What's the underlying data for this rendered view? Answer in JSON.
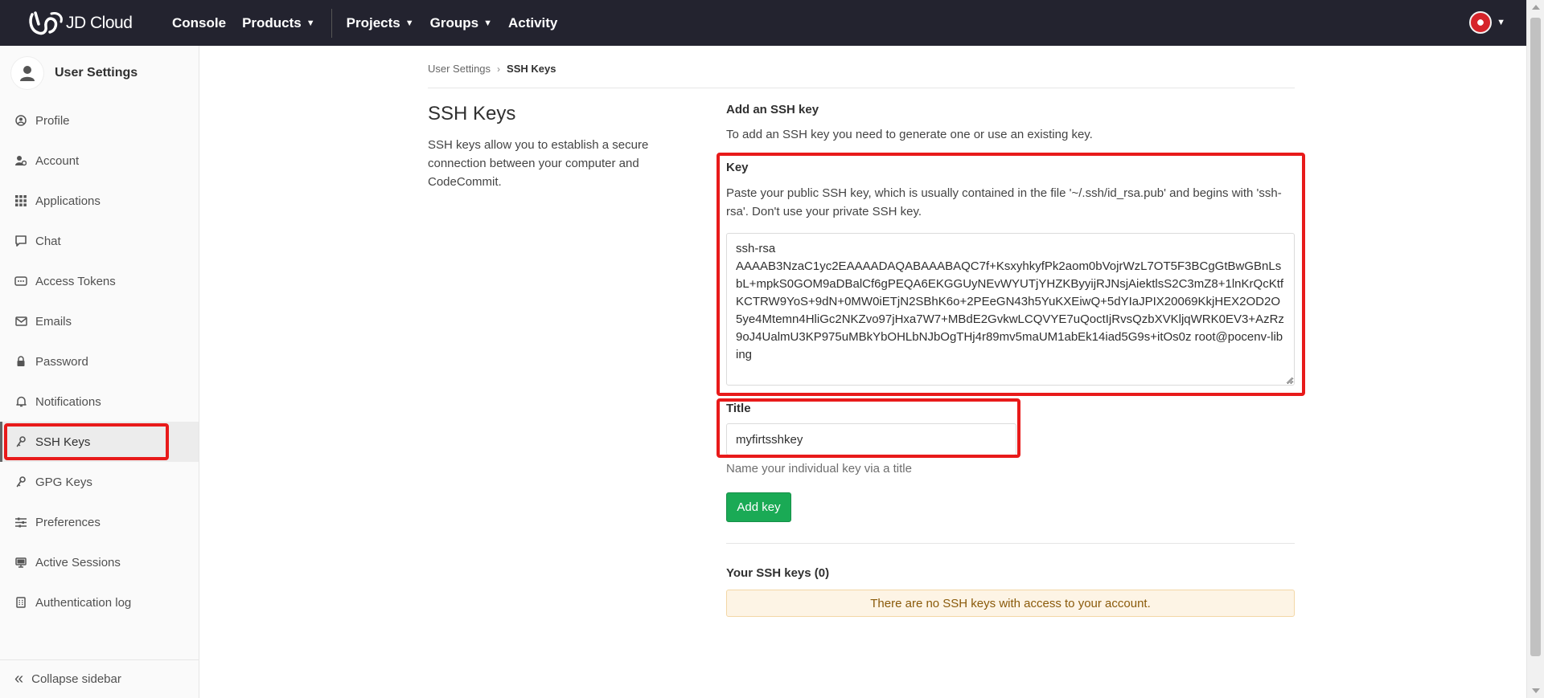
{
  "topnav": {
    "brand": "JD Cloud",
    "items": [
      {
        "label": "Console",
        "caret": false
      },
      {
        "label": "Products",
        "caret": true
      },
      {
        "label": "Projects",
        "caret": true
      },
      {
        "label": "Groups",
        "caret": true
      },
      {
        "label": "Activity",
        "caret": false
      }
    ],
    "icons": [
      "jdcloud-logo-icon",
      "user-avatar-icon",
      "chevron-down-icon"
    ]
  },
  "sidebar": {
    "title": "User Settings",
    "items": [
      {
        "label": "Profile",
        "icon": "profile-icon"
      },
      {
        "label": "Account",
        "icon": "account-icon"
      },
      {
        "label": "Applications",
        "icon": "applications-icon"
      },
      {
        "label": "Chat",
        "icon": "chat-icon"
      },
      {
        "label": "Access Tokens",
        "icon": "token-icon"
      },
      {
        "label": "Emails",
        "icon": "email-icon"
      },
      {
        "label": "Password",
        "icon": "lock-icon"
      },
      {
        "label": "Notifications",
        "icon": "bell-icon"
      },
      {
        "label": "SSH Keys",
        "icon": "key-icon",
        "active": true
      },
      {
        "label": "GPG Keys",
        "icon": "key-icon"
      },
      {
        "label": "Preferences",
        "icon": "preferences-icon"
      },
      {
        "label": "Active Sessions",
        "icon": "monitor-icon"
      },
      {
        "label": "Authentication log",
        "icon": "log-icon"
      }
    ],
    "collapse_label": "Collapse sidebar"
  },
  "breadcrumb": {
    "parent": "User Settings",
    "current": "SSH Keys"
  },
  "page": {
    "title": "SSH Keys",
    "description": "SSH keys allow you to establish a secure connection between your computer and CodeCommit."
  },
  "form": {
    "section_title": "Add an SSH key",
    "section_subtitle": "To add an SSH key you need to generate one or use an existing key.",
    "key_label": "Key",
    "key_help": "Paste your public SSH key, which is usually contained in the file '~/.ssh/id_rsa.pub' and begins with 'ssh-rsa'. Don't use your private SSH key.",
    "key_value": "ssh-rsa\nAAAAB3NzaC1yc2EAAAADAQABAAABAQC7f+KsxyhkyfPk2aom0bVojrWzL7OT5F3BCgGtBwGBnLsbL+mpkS0GOM9aDBalCf6gPEQA6EKGGUyNEvWYUTjYHZKByyijRJNsjAiektlsS2C3mZ8+1lnKrQcKtfKCTRW9YoS+9dN+0MW0iETjN2SBhK6o+2PEeGN43h5YuKXEiwQ+5dYIaJPIX20069KkjHEX2OD2O5ye4Mtemn4HliGc2NKZvo97jHxa7W7+MBdE2GvkwLCQVYE7uQoctIjRvsQzbXVKljqWRK0EV3+AzRz9oJ4UalmU3KP975uMBkYbOHLbNJbOgTHj4r89mv5maUM1abEk14iad5G9s+itOs0z root@pocenv-libing",
    "title_label": "Title",
    "title_value": "myfirtsshkey",
    "title_help": "Name your individual key via a title",
    "submit_label": "Add key"
  },
  "list": {
    "title": "Your SSH keys (0)",
    "empty_message": "There are no SSH keys with access to your account."
  },
  "colors": {
    "topnav_bg": "#23232f",
    "highlight": "#e81a1a",
    "button": "#1aaa55",
    "alert_bg": "#fdf4e5"
  }
}
